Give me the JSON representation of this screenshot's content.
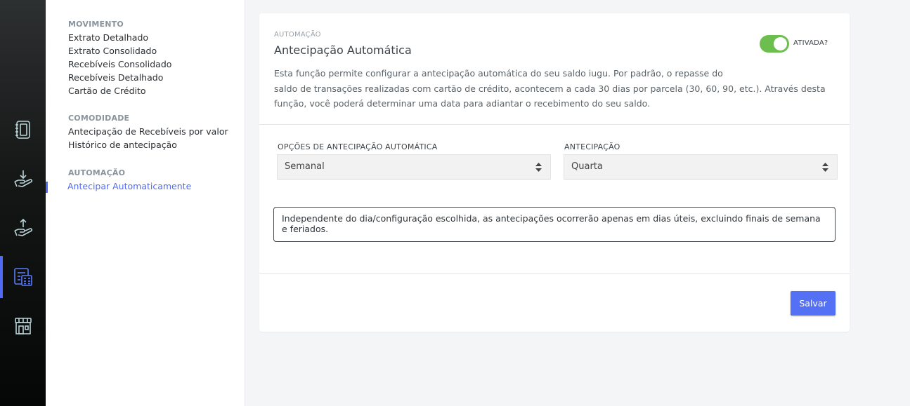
{
  "rail": {
    "items": [
      {
        "icon": "ledger-book-icon",
        "active": false
      },
      {
        "icon": "receive-money-icon",
        "active": false
      },
      {
        "icon": "send-money-icon",
        "active": false
      },
      {
        "icon": "calculator-icon",
        "active": true
      },
      {
        "icon": "storefront-icon",
        "active": false
      }
    ],
    "accent": "#4f6bf5"
  },
  "subnav": {
    "groups": [
      {
        "title": "MOVIMENTO",
        "items": [
          "Extrato Detalhado",
          "Extrato Consolidado",
          "Recebíveis Consolidado",
          "Recebíveis Detalhado",
          "Cartão de Crédito"
        ]
      },
      {
        "title": "COMODIDADE",
        "items": [
          "Antecipação de Recebíveis por valor",
          "Histórico de antecipação"
        ]
      },
      {
        "title": "AUTOMAÇÃO",
        "items": [
          "Antecipar Automaticamente"
        ]
      }
    ],
    "active_item": "Antecipar Automaticamente"
  },
  "card": {
    "section_label": "AUTOMAÇÃO",
    "title": "Antecipação Automática",
    "description_line1": "Esta função permite configurar a antecipação automática do seu saldo iugu. Por padrão, o repasse do",
    "description_line2": "saldo de transações realizadas com cartão de crédito, acontecem a cada 30 dias por parcela (30, 60, 90, etc.). Através desta",
    "description_line3": "função, você poderá determinar uma data para adiantar o recebimento do seu saldo.",
    "toggle": {
      "label": "ATIVADA?",
      "on": true,
      "color": "#6cbf4f"
    },
    "options": {
      "label": "OPÇÕES DE ANTECIPAÇÃO AUTOMÁTICA",
      "value": "Semanal"
    },
    "antecipacao": {
      "label": "ANTECIPAÇÃO",
      "value": "Quarta"
    },
    "notice": "Independente do dia/configuração escolhida, as antecipações ocorrerão apenas em dias úteis, excluindo finais de semana e feriados.",
    "save_label": "Salvar",
    "save_color": "#5470f5"
  }
}
